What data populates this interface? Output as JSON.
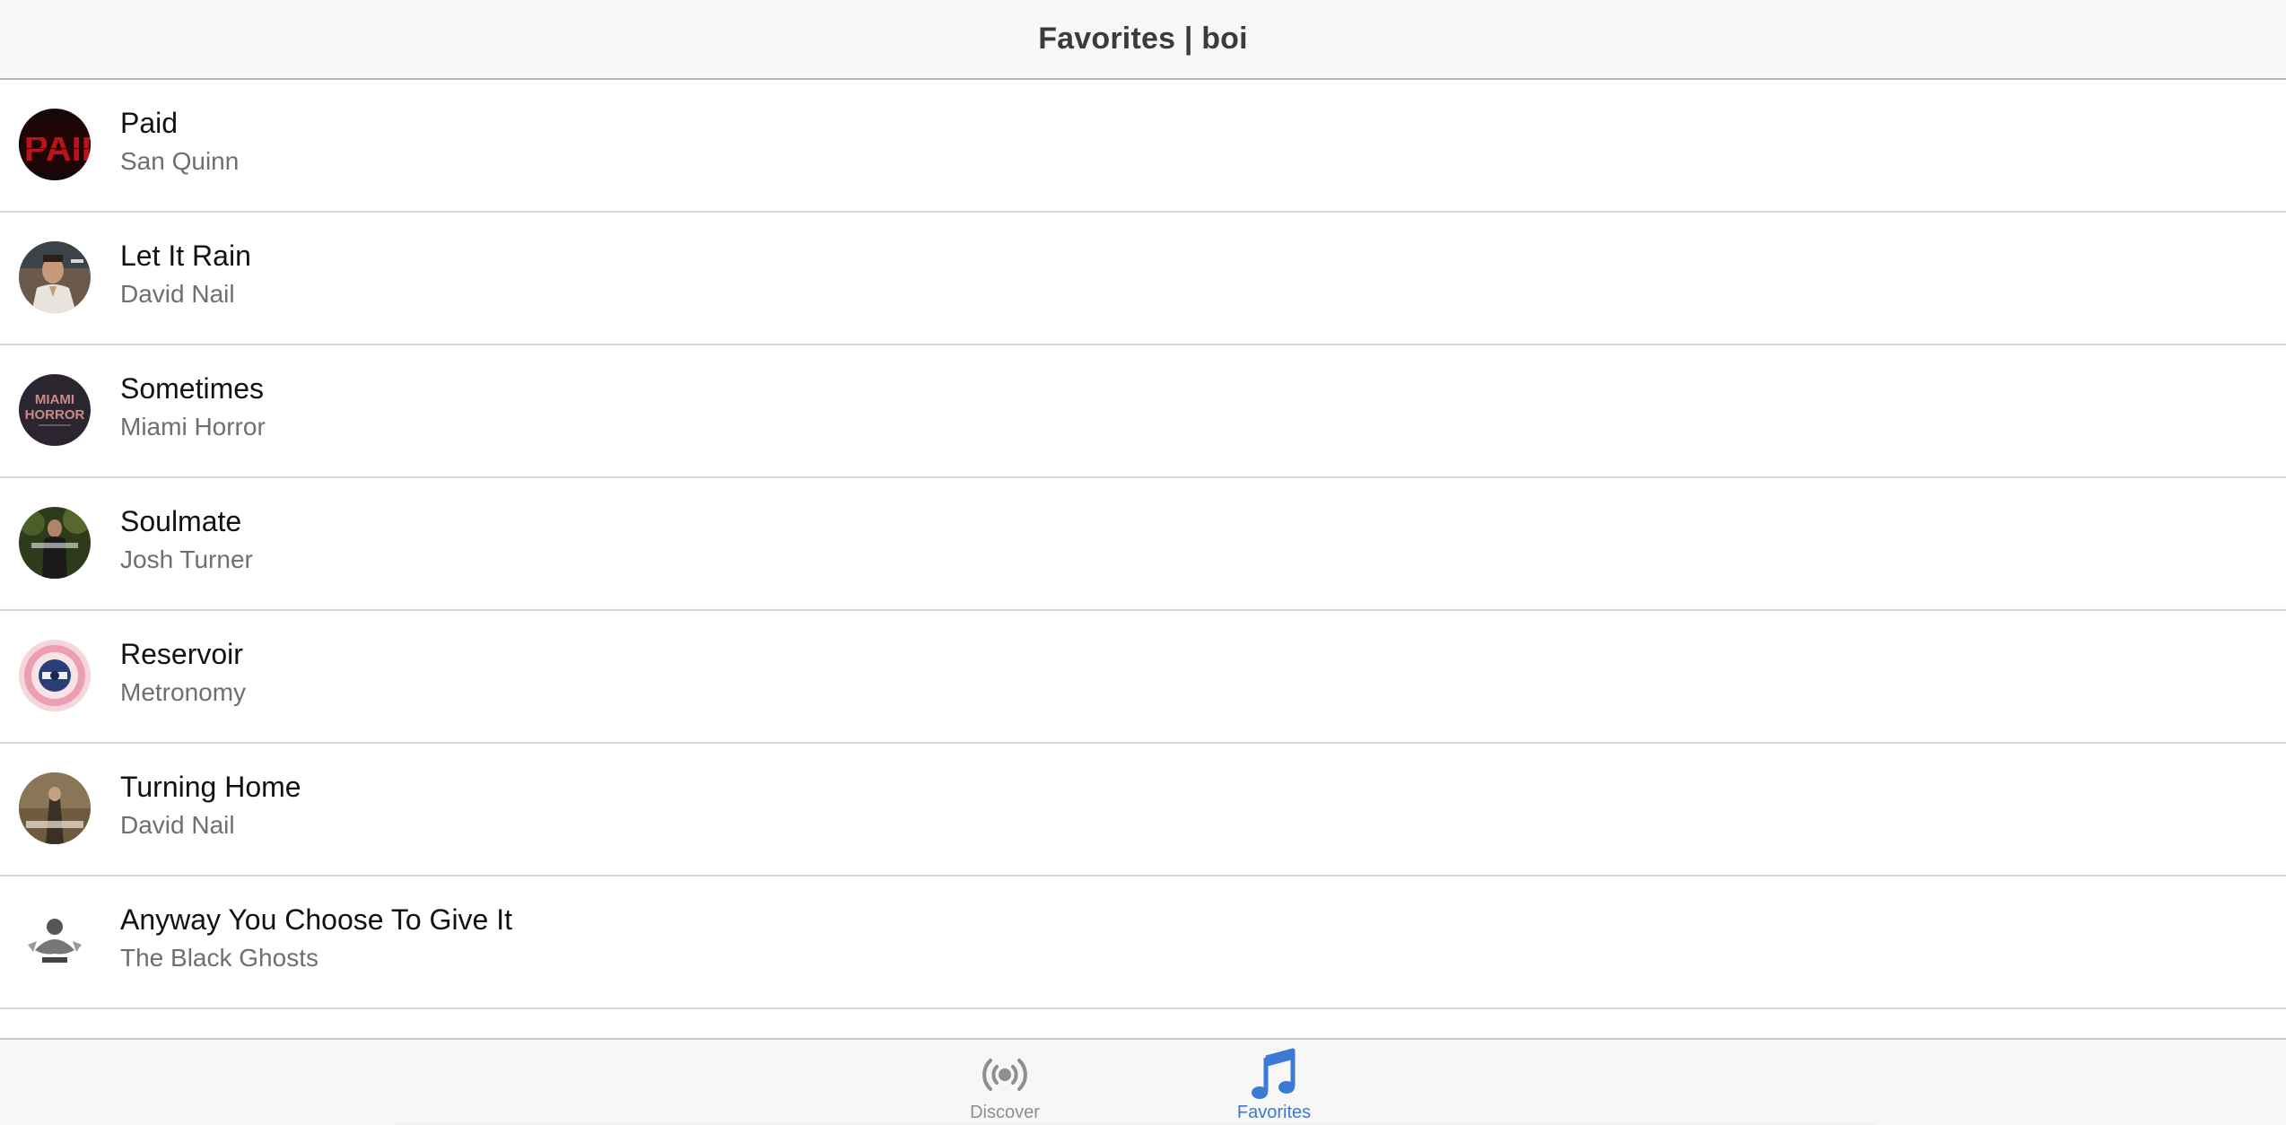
{
  "header": {
    "title": "Favorites | boi"
  },
  "favorites": [
    {
      "title": "Paid",
      "artist": "San Quinn",
      "art": "paid"
    },
    {
      "title": "Let It Rain",
      "artist": "David Nail",
      "art": "portrait"
    },
    {
      "title": "Sometimes",
      "artist": "Miami Horror",
      "art": "miami"
    },
    {
      "title": "Soulmate",
      "artist": "Josh Turner",
      "art": "josh"
    },
    {
      "title": "Reservoir",
      "artist": "Metronomy",
      "art": "metronomy"
    },
    {
      "title": "Turning Home",
      "artist": "David Nail",
      "art": "davidnail"
    },
    {
      "title": "Anyway You Choose To Give It",
      "artist": "The Black Ghosts",
      "art": "ghosts"
    }
  ],
  "tabbar": {
    "discover_label": "Discover",
    "favorites_label": "Favorites",
    "active_tab": "Favorites",
    "discover_icon": "broadcast-icon",
    "favorites_icon": "music-note-icon",
    "active_color": "#3a7bd5",
    "inactive_color": "#8e8e93"
  }
}
